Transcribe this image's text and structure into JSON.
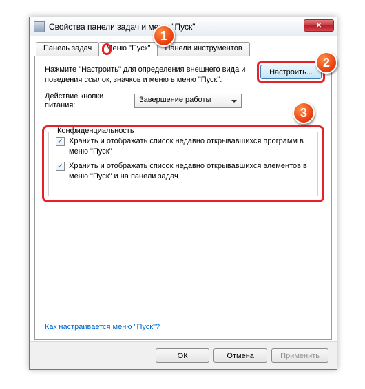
{
  "window": {
    "title": "Свойства панели задач и меню \"Пуск\""
  },
  "tabs": {
    "taskbar": "Панель задач",
    "startmenu": "Меню \"Пуск\"",
    "toolbars": "Панели инструментов"
  },
  "startmenu": {
    "description": "Нажмите \"Настроить\" для определения внешнего вида и поведения ссылок, значков и меню в меню \"Пуск\".",
    "customize_btn": "Настроить...",
    "power_label": "Действие кнопки питания:",
    "power_value": "Завершение работы",
    "privacy_group": "Конфиденциальность",
    "privacy_opt1": "Хранить и отображать список недавно открывавшихся программ в меню \"Пуск\"",
    "privacy_opt2": "Хранить и отображать список недавно открывавшихся элементов в меню \"Пуск\" и на панели задач",
    "help_link": "Как настраивается меню \"Пуск\"?"
  },
  "footer": {
    "ok": "ОК",
    "cancel": "Отмена",
    "apply": "Применить"
  },
  "markers": {
    "m1": "1",
    "m2": "2",
    "m3": "3"
  }
}
